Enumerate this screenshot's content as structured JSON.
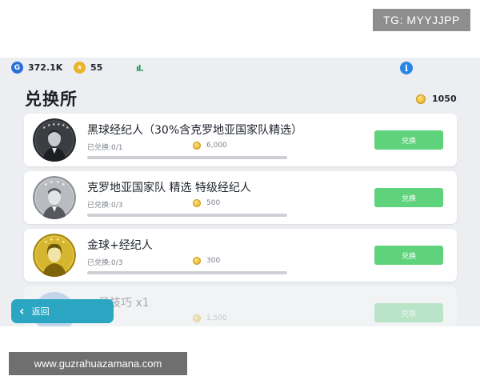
{
  "overlay": {
    "tg_label": "TG: MYYJJPP",
    "site_watermark": "www.guzrahuazamana.com"
  },
  "topbar": {
    "gp_icon_letter": "G",
    "gp_value": "372.1K",
    "stars_value": "55",
    "signal_glyph": "ıl."
  },
  "page": {
    "title": "兑换所",
    "balance": "1050"
  },
  "items": [
    {
      "name": "黑球经纪人（30%含克罗地亚国家队精选）",
      "redeemed": "已兑换:0/1",
      "cost": "6,000",
      "button": "兑换",
      "progress": 0.0,
      "avatar_style": "black"
    },
    {
      "name": "克罗地亚国家队 精选 特级经纪人",
      "redeemed": "已兑换:0/3",
      "cost": "500",
      "button": "兑换",
      "progress": 0.0,
      "avatar_style": "silver"
    },
    {
      "name": "金球+经纪人",
      "redeemed": "已兑换:0/3",
      "cost": "300",
      "button": "兑换",
      "progress": 0.0,
      "avatar_style": "gold"
    },
    {
      "name": "…员技巧 x1",
      "redeemed": "",
      "cost": "1,500",
      "button": "兑换",
      "progress": 0.0,
      "avatar_style": "blue"
    }
  ],
  "nav": {
    "back_label": "返回",
    "back_icon": "chevron-left-icon"
  },
  "colors": {
    "button_green": "#5ed37b",
    "back_teal": "#2aa6c2",
    "page_bg": "#eceef1"
  }
}
